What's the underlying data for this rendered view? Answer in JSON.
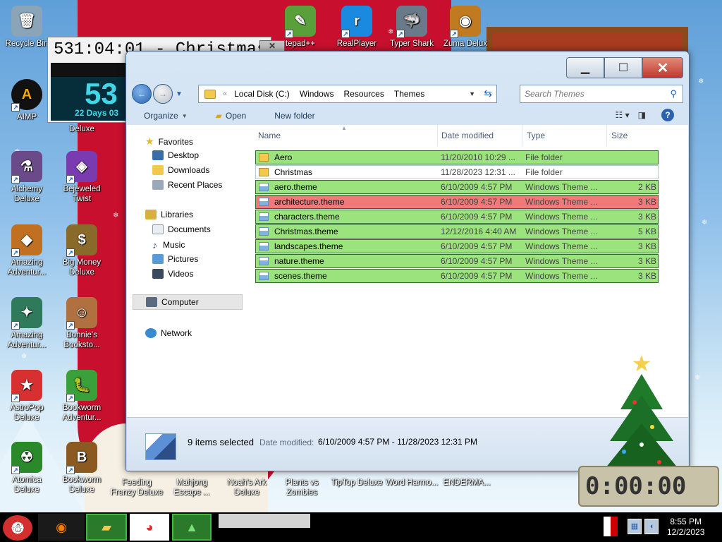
{
  "desktop": {
    "icons": [
      {
        "label": "Recycle Bin",
        "glyph": "🗑",
        "color": "#8aa4b8"
      },
      {
        "label": "AIMP",
        "glyph": "A",
        "color": "#f2a900"
      },
      {
        "label": "Alchemy Deluxe",
        "glyph": "⚗",
        "color": "#6b4a8a"
      },
      {
        "label": "Amazing Adventur...",
        "glyph": "◆",
        "color": "#c07020"
      },
      {
        "label": "Amazing Adventur...",
        "glyph": "✦",
        "color": "#2e7a5a"
      },
      {
        "label": "AstroPop Deluxe",
        "glyph": "★",
        "color": "#d83030"
      },
      {
        "label": "Atomica Deluxe",
        "glyph": "☢",
        "color": "#2a8a2a"
      },
      {
        "label": "Deluxe",
        "glyph": "",
        "color": ""
      },
      {
        "label": "Bejeweled Twist",
        "glyph": "◈",
        "color": "#7a3ab0"
      },
      {
        "label": "Big Money Deluxe",
        "glyph": "$",
        "color": "#8a6a2a"
      },
      {
        "label": "Bonnie's Booksto...",
        "glyph": "☺",
        "color": "#b07040"
      },
      {
        "label": "Bookworm Adventur...",
        "glyph": "🐛",
        "color": "#3aa03a"
      },
      {
        "label": "Bookworm Deluxe",
        "glyph": "B",
        "color": "#8a5a20"
      },
      {
        "label": "Feeding Frenzy Deluxe",
        "glyph": "",
        "color": ""
      },
      {
        "label": "Mahjong Escape ...",
        "glyph": "",
        "color": ""
      },
      {
        "label": "Noah's Ark Deluxe",
        "glyph": "",
        "color": ""
      },
      {
        "label": "Plants vs Zombies",
        "glyph": "",
        "color": ""
      },
      {
        "label": "TipTop Deluxe",
        "glyph": "",
        "color": ""
      },
      {
        "label": "Word Harmo...",
        "glyph": "",
        "color": ""
      },
      {
        "label": "ENDERMA...",
        "glyph": "",
        "color": ""
      },
      {
        "label": "tepad++",
        "glyph": "✎",
        "color": "#5aa03a"
      },
      {
        "label": "RealPlayer",
        "glyph": "r",
        "color": "#1a8ae0"
      },
      {
        "label": "Typer Shark",
        "glyph": "🦈",
        "color": "#6a7a8a"
      },
      {
        "label": "Zuma Delux",
        "glyph": "◉",
        "color": "#c07a20"
      }
    ]
  },
  "countdown": {
    "title": "531:04:01 - Christmas",
    "big_number": "53",
    "days_text": "22 Days 03",
    "close_label": "✕"
  },
  "explorer": {
    "breadcrumb": [
      "Local Disk (C:)",
      "Windows",
      "Resources",
      "Themes"
    ],
    "search_placeholder": "Search Themes",
    "toolbar": {
      "organize": "Organize",
      "open": "Open",
      "new_folder": "New folder"
    },
    "nav": {
      "favorites": "Favorites",
      "desktop": "Desktop",
      "downloads": "Downloads",
      "recent_places": "Recent Places",
      "libraries": "Libraries",
      "documents": "Documents",
      "music": "Music",
      "pictures": "Pictures",
      "videos": "Videos",
      "computer": "Computer",
      "network": "Network"
    },
    "columns": {
      "name": "Name",
      "date": "Date modified",
      "type": "Type",
      "size": "Size"
    },
    "files": [
      {
        "name": "Aero",
        "date": "11/20/2010 10:29 ...",
        "type": "File folder",
        "size": "",
        "kind": "folder",
        "highlight": "#9be37c"
      },
      {
        "name": "Christmas",
        "date": "11/28/2023 12:31 ...",
        "type": "File folder",
        "size": "",
        "kind": "folder",
        "highlight": "#ffffff"
      },
      {
        "name": "aero.theme",
        "date": "6/10/2009 4:57 PM",
        "type": "Windows Theme ...",
        "size": "2 KB",
        "kind": "theme",
        "highlight": "#9be37c"
      },
      {
        "name": "architecture.theme",
        "date": "6/10/2009 4:57 PM",
        "type": "Windows Theme ...",
        "size": "3 KB",
        "kind": "theme",
        "highlight": "#f07a7a"
      },
      {
        "name": "characters.theme",
        "date": "6/10/2009 4:57 PM",
        "type": "Windows Theme ...",
        "size": "3 KB",
        "kind": "theme",
        "highlight": "#9be37c"
      },
      {
        "name": "Christmas.theme",
        "date": "12/12/2016 4:40 AM",
        "type": "Windows Theme ...",
        "size": "5 KB",
        "kind": "theme",
        "highlight": "#9be37c"
      },
      {
        "name": "landscapes.theme",
        "date": "6/10/2009 4:57 PM",
        "type": "Windows Theme ...",
        "size": "3 KB",
        "kind": "theme",
        "highlight": "#9be37c"
      },
      {
        "name": "nature.theme",
        "date": "6/10/2009 4:57 PM",
        "type": "Windows Theme ...",
        "size": "3 KB",
        "kind": "theme",
        "highlight": "#9be37c"
      },
      {
        "name": "scenes.theme",
        "date": "6/10/2009 4:57 PM",
        "type": "Windows Theme ...",
        "size": "3 KB",
        "kind": "theme",
        "highlight": "#9be37c"
      }
    ],
    "status": {
      "count": "9 items selected",
      "date_label": "Date modified:",
      "date_value": "6/10/2009 4:57 PM - 11/28/2023 12:31 PM"
    }
  },
  "tray_clock": {
    "time": "8:55 PM",
    "date": "12/2/2023"
  },
  "clock_widget": "0:00:00"
}
